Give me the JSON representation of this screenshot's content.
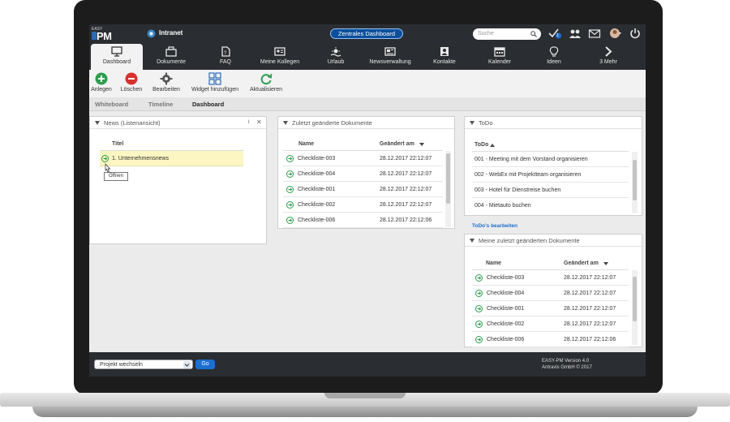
{
  "header": {
    "logo_small": "EASY",
    "logo_big": "PM",
    "intranet_label": "Intranet",
    "dashboard_pill": "Zentrales Dashboard",
    "search_placeholder": "Suche",
    "notification_count": "1"
  },
  "nav": {
    "items": [
      {
        "label": "Dashboard",
        "icon": "dashboard-icon"
      },
      {
        "label": "Dokumente",
        "icon": "documents-icon"
      },
      {
        "label": "FAQ",
        "icon": "faq-icon"
      },
      {
        "label": "Meine Kollegen",
        "icon": "colleagues-icon"
      },
      {
        "label": "Urlaub",
        "icon": "vacation-icon"
      },
      {
        "label": "Newsverwaltung",
        "icon": "news-icon"
      },
      {
        "label": "Kontakte",
        "icon": "contacts-icon"
      },
      {
        "label": "Kalender",
        "icon": "calendar-icon"
      },
      {
        "label": "Ideen",
        "icon": "ideas-icon"
      },
      {
        "label": "3 Mehr",
        "icon": "more-icon"
      }
    ]
  },
  "toolbar": {
    "add": "Anlegen",
    "delete": "Löschen",
    "edit": "Bearbeiten",
    "add_widget": "Widget hinzufügen",
    "refresh": "Aktualisieren"
  },
  "tabs": {
    "whiteboard": "Whiteboard",
    "timeline": "Timeline",
    "dashboard": "Dashboard"
  },
  "news_widget": {
    "title": "News (Listenansicht)",
    "info": "i",
    "close": "✕",
    "column": "Titel",
    "item": "1. Unternehmensnews",
    "tooltip": "Öffnen"
  },
  "docs_widget": {
    "title": "Zuletzt geänderte Dokumente",
    "col_name": "Name",
    "col_date": "Geändert am",
    "rows": [
      {
        "name": "Checkliste-003",
        "date": "28.12.2017 22:12:07"
      },
      {
        "name": "Checkliste-004",
        "date": "28.12.2017 22:12:07"
      },
      {
        "name": "Checkliste-001",
        "date": "28.12.2017 22:12:07"
      },
      {
        "name": "Checkliste-002",
        "date": "28.12.2017 22:12:07"
      },
      {
        "name": "Checkliste-006",
        "date": "28.12.2017 22:12:06"
      }
    ]
  },
  "todo_widget": {
    "title": "ToDo",
    "column": "ToDo",
    "rows": [
      "001 - Meeting mit dem Vorstand organisieren",
      "002 - WebEx mit Projektteam organisieren",
      "003 - Hotel für Dienstreise buchen",
      "004 - Mietauto buchen"
    ],
    "edit_link": "ToDo's bearbeiten"
  },
  "mydocs_widget": {
    "title": "Meine zuletzt geänderten Dokumente",
    "col_name": "Name",
    "col_date": "Geändert am",
    "rows": [
      {
        "name": "Checkliste-003",
        "date": "28.12.2017 22:12:07"
      },
      {
        "name": "Checkliste-004",
        "date": "28.12.2017 22:12:07"
      },
      {
        "name": "Checkliste-001",
        "date": "28.12.2017 22:12:07"
      },
      {
        "name": "Checkliste-002",
        "date": "28.12.2017 22:12:07"
      },
      {
        "name": "Checkliste-006",
        "date": "28.12.2017 22:12:06"
      }
    ]
  },
  "footer": {
    "project_select": "Projekt wechseln",
    "go": "Go",
    "version": "EASY-PM Version 4.0",
    "copyright": "Antravis GmbH © 2017"
  },
  "colors": {
    "accent": "#1b6fd1",
    "chrome": "#2a2d31",
    "go_green": "#2e9e4f",
    "delete_red": "#d9302c"
  }
}
